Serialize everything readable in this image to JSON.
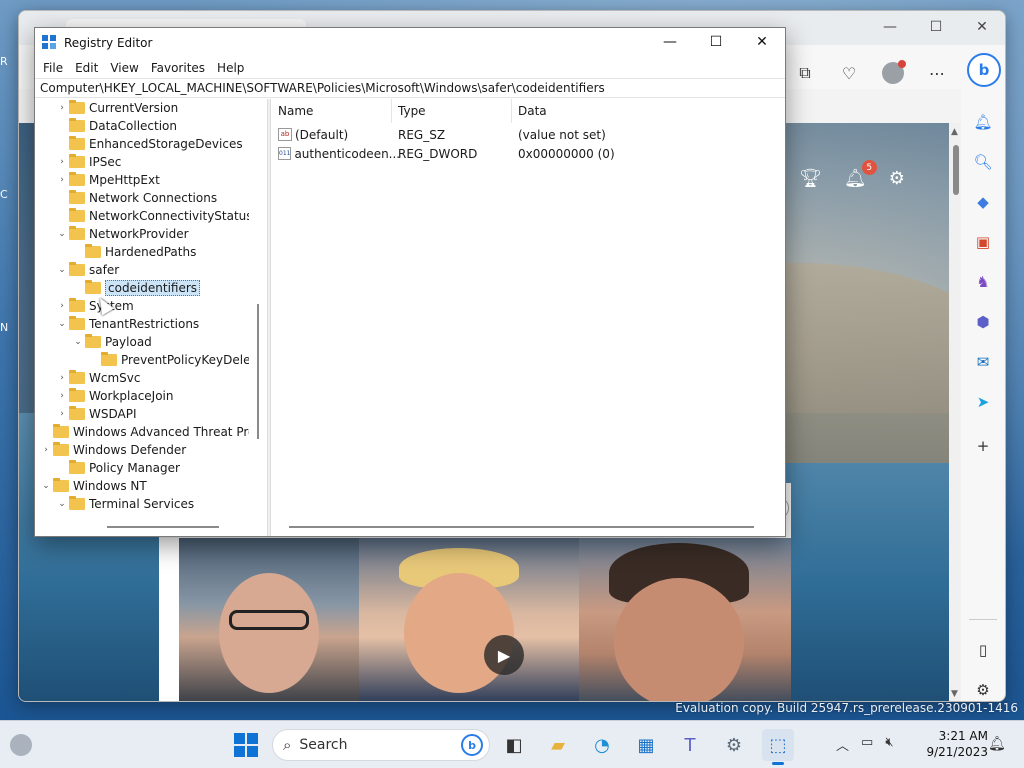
{
  "desktop": {
    "left_labels": [
      "R",
      "C",
      "N"
    ]
  },
  "edge": {
    "window_controls": {
      "minimize": "—",
      "maximize": "☐",
      "close": "✕"
    },
    "msn": {
      "notification_count": "5"
    }
  },
  "regedit": {
    "title": "Registry Editor",
    "window_controls": {
      "minimize": "—",
      "maximize": "☐",
      "close": "✕"
    },
    "menu": [
      "File",
      "Edit",
      "View",
      "Favorites",
      "Help"
    ],
    "address": "Computer\\HKEY_LOCAL_MACHINE\\SOFTWARE\\Policies\\Microsoft\\Windows\\safer\\codeidentifiers",
    "tree": [
      {
        "label": "CurrentVersion",
        "indent": 1,
        "chev": "›"
      },
      {
        "label": "DataCollection",
        "indent": 1,
        "chev": ""
      },
      {
        "label": "EnhancedStorageDevices",
        "indent": 1,
        "chev": ""
      },
      {
        "label": "IPSec",
        "indent": 1,
        "chev": "›"
      },
      {
        "label": "MpeHttpExt",
        "indent": 1,
        "chev": "›"
      },
      {
        "label": "Network Connections",
        "indent": 1,
        "chev": ""
      },
      {
        "label": "NetworkConnectivityStatusIndicator",
        "indent": 1,
        "chev": ""
      },
      {
        "label": "NetworkProvider",
        "indent": 1,
        "chev": "⌄"
      },
      {
        "label": "HardenedPaths",
        "indent": 2,
        "chev": ""
      },
      {
        "label": "safer",
        "indent": 1,
        "chev": "⌄"
      },
      {
        "label": "codeidentifiers",
        "indent": 2,
        "chev": "",
        "selected": true
      },
      {
        "label": "System",
        "indent": 1,
        "chev": "›"
      },
      {
        "label": "TenantRestrictions",
        "indent": 1,
        "chev": "⌄"
      },
      {
        "label": "Payload",
        "indent": 2,
        "chev": "⌄"
      },
      {
        "label": "PreventPolicyKeyDelete",
        "indent": 3,
        "chev": ""
      },
      {
        "label": "WcmSvc",
        "indent": 1,
        "chev": "›"
      },
      {
        "label": "WorkplaceJoin",
        "indent": 1,
        "chev": "›"
      },
      {
        "label": "WSDAPI",
        "indent": 1,
        "chev": "›"
      },
      {
        "label": "Windows Advanced Threat Protection",
        "indent": 0,
        "chev": ""
      },
      {
        "label": "Windows Defender",
        "indent": 0,
        "chev": "›"
      },
      {
        "label": "Policy Manager",
        "indent": 1,
        "chev": ""
      },
      {
        "label": "Windows NT",
        "indent": 0,
        "chev": "⌄"
      },
      {
        "label": "Terminal Services",
        "indent": 1,
        "chev": "⌄"
      }
    ],
    "columns": {
      "name": "Name",
      "type": "Type",
      "data": "Data"
    },
    "values": [
      {
        "icon": "ab",
        "name": "(Default)",
        "type": "REG_SZ",
        "data": "(value not set)"
      },
      {
        "icon": "011",
        "name": "authenticodeen...",
        "type": "REG_DWORD",
        "data": "0x00000000 (0)"
      }
    ]
  },
  "watermark": "Evaluation copy. Build 25947.rs_prerelease.230901-1416",
  "taskbar": {
    "search_placeholder": "Search",
    "time": "3:21 AM",
    "date": "9/21/2023"
  }
}
